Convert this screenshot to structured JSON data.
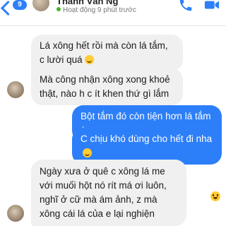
{
  "header": {
    "contact_name": "Thanh Văn Ng",
    "presence": "Hoạt động 9 phút trước",
    "unread_count": "9",
    "icons": [
      "back-icon",
      "phone-icon",
      "video-call-icon"
    ],
    "accent_color": "#2d7ff9"
  },
  "messages": [
    {
      "side": "in",
      "text": "Lá xông hết rồi mà còn lá tắm, c lười quá",
      "emoji": "grinning-sweat-emoji"
    },
    {
      "side": "in",
      "text": "Mà công nhận xông xong khoẻ thật, nào h c ít khen thứ gì lắm"
    },
    {
      "side": "out",
      "text": "Bột tắm đó còn tiện hơn lá tắm ý"
    },
    {
      "side": "out",
      "text": "C chịu khó dùng cho hết đi nha",
      "emoji": "grinning-sweat-emoji"
    },
    {
      "side": "in",
      "text": "Ngày xưa ở quê c xông lá me với muối hột nó rít má ơi luôn, nghĩ ở cữ mà ám ảnh, z mà xông cái lá của e lại nghiện"
    }
  ],
  "colors": {
    "incoming_bubble": "#f0f0f0",
    "outgoing_bubble": "#2d7ff9"
  }
}
